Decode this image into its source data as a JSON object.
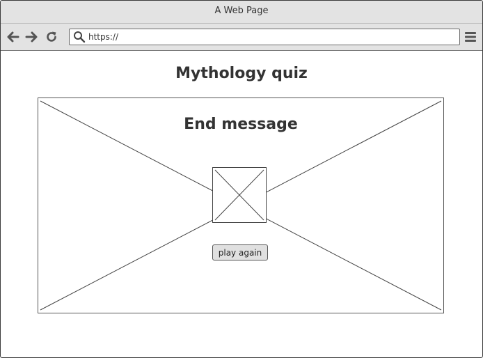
{
  "window": {
    "title": "A Web Page"
  },
  "toolbar": {
    "back_icon": "arrow-left-icon",
    "forward_icon": "arrow-right-icon",
    "reload_icon": "reload-icon",
    "menu_icon": "hamburger-menu-icon",
    "url": {
      "value": "https://",
      "icon": "search-icon"
    }
  },
  "page": {
    "title": "Mythology quiz",
    "panel": {
      "heading": "End message",
      "image_icon": "image-placeholder-icon",
      "button_label": "play again"
    }
  }
}
